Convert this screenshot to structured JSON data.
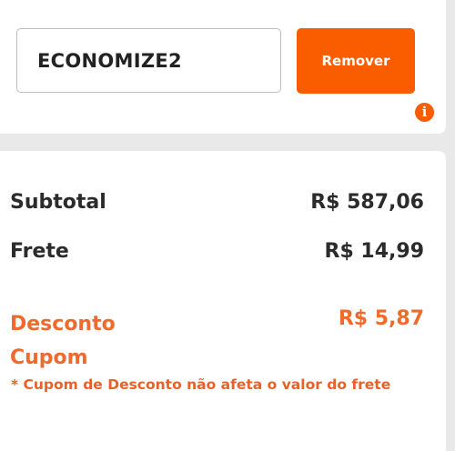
{
  "coupon": {
    "code_value": "ECONOMIZE2",
    "remove_label": "Remover",
    "info_glyph": "i",
    "info_icon": "info-circle-icon"
  },
  "summary": {
    "subtotal_label": "Subtotal",
    "subtotal_value": "R$ 587,06",
    "frete_label": "Frete",
    "frete_value": "R$ 14,99",
    "discount_label": "Desconto Cupom",
    "discount_value": "R$ 5,87",
    "discount_note": "* Cupom de Desconto não afeta o valor do frete"
  },
  "colors": {
    "accent": "#fa5c00",
    "discount_text": "#ee6a2d",
    "text": "#2b2b2b",
    "page_bg": "#e9e9e9"
  }
}
